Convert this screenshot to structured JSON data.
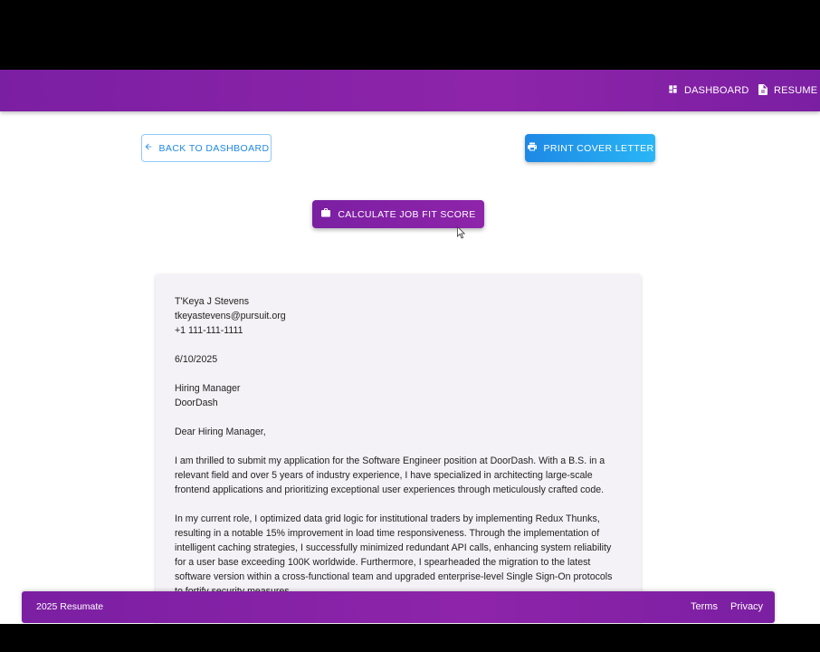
{
  "nav": {
    "items": [
      {
        "label": "DASHBOARD",
        "icon": "dashboard-icon"
      },
      {
        "label": "RESUME B",
        "icon": "document-icon"
      }
    ]
  },
  "actions": {
    "back_label": "BACK TO DASHBOARD",
    "print_label": "PRINT COVER LETTER",
    "calc_label": "CALCULATE JOB FIT SCORE"
  },
  "letter": {
    "name": "T'Keya J Stevens",
    "email": "tkeyastevens@pursuit.org",
    "phone": "+1 111-111-1111",
    "date": "6/10/2025",
    "recipient_title": "Hiring Manager",
    "recipient_company": "DoorDash",
    "salutation": "Dear Hiring Manager,",
    "paragraphs": [
      "I am thrilled to submit my application for the Software Engineer position at DoorDash. With a B.S. in a relevant field and over 5 years of industry experience, I have specialized in architecting large-scale frontend applications and prioritizing exceptional user experiences through meticulously crafted code.",
      "In my current role, I optimized data grid logic for institutional traders by implementing Redux Thunks, resulting in a notable 15% improvement in load time responsiveness. Through the implementation of intelligent caching strategies, I successfully minimized redundant API calls, enhancing system reliability for a user base exceeding 100K worldwide. Furthermore, I spearheaded the migration to the latest software version within a cross-functional team and upgraded enterprise-level Single Sign-On protocols to fortify security measures."
    ]
  },
  "footer": {
    "copyright": "2025 Resumate",
    "terms": "Terms",
    "privacy": "Privacy"
  },
  "colors": {
    "brand_purple": "#8e24aa",
    "accent_blue": "#1e88e5"
  }
}
